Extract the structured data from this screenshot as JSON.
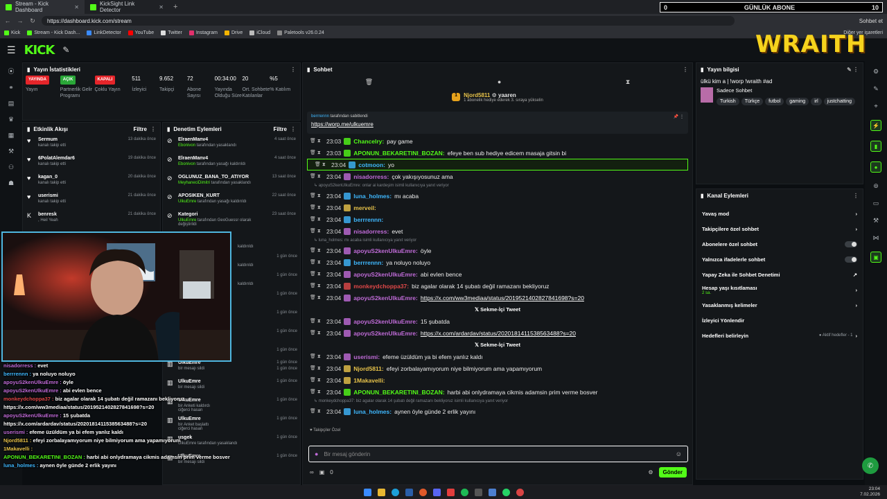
{
  "browser": {
    "tabs": [
      {
        "label": "Stream - Kick Dashboard",
        "active": true
      },
      {
        "label": "KickSight Link Detector",
        "active": false
      }
    ],
    "new_tab": "+",
    "url": "https://dashboard.kick.com/stream",
    "bookmarks": [
      "Kick",
      "Stream - Kick Dash...",
      "LinkDetector",
      "YouTube",
      "Twitter",
      "Instagram",
      "Drive",
      "iCloud",
      "Paletools v26.0.24"
    ],
    "other_bookmarks": "Diğer yer işaretleri",
    "chat_button": "Sohbet et"
  },
  "goal_overlay": {
    "left": "0",
    "label": "GÜNLÜK ABONE",
    "right": "10"
  },
  "wraith": "WRAITH",
  "stats_panel": {
    "title": "Yayın İstatistikleri",
    "items": [
      {
        "val": "YAYINDA",
        "label": "Yayın",
        "color": "#e5252a"
      },
      {
        "val": "AÇIK",
        "label": "Partnerlik Gelir Programı",
        "color": "#2aa738"
      },
      {
        "val": "KAPALI",
        "label": "Çoklu Yayın",
        "color": "#e5252a"
      },
      {
        "val": "511",
        "label": "İzleyici"
      },
      {
        "val": "9.652",
        "label": "Takipçi"
      },
      {
        "val": "72",
        "label": "Abone Sayısı"
      },
      {
        "val": "00:34:00",
        "label": "Yayında Olduğu Süre"
      },
      {
        "val": "20",
        "label": "Ort. Sohbete Katılanlar"
      },
      {
        "val": "%5",
        "label": "% Katılım"
      }
    ]
  },
  "activity": {
    "title": "Etkinlik Akışı",
    "filter": "Filtre",
    "items": [
      {
        "name": "Sermum",
        "sub": "kanalı takip etti",
        "time": "13 dakika önce"
      },
      {
        "name": "6PolatAlemdar6",
        "sub": "kanalı takip etti",
        "time": "19 dakika önce"
      },
      {
        "name": "kagan_0",
        "sub": "kanalı takip etti",
        "time": "20 dakika önce"
      },
      {
        "name": "userismi",
        "sub": "kanalı takip etti",
        "time": "21 dakika önce"
      },
      {
        "name": "benresk",
        "sub": ", Heil Yeah",
        "time": "21 dakika önce"
      }
    ]
  },
  "moderation": {
    "title": "Denetim Eylemleri",
    "filter": "Filtre",
    "items": [
      {
        "name": "ElraenManv4",
        "sub_user": "Ebonivon",
        "sub": "tarafından yasaklandı",
        "time": "4 saat önce"
      },
      {
        "name": "ElraenManv4",
        "sub_user": "Ebonivon",
        "sub": "tarafından yasağı kaldırıldı",
        "time": "4 saat önce"
      },
      {
        "name": "OGLUNUZ_BANA_TO_ATIYOR",
        "sub_user": "MeyhaneciDimitri",
        "sub": "tarafından yasaklandı",
        "time": "13 saat önce"
      },
      {
        "name": "APOSIKEN_KURT",
        "sub_user": "UlkuEmre",
        "sub": "tarafından yasağı kaldırıldı",
        "time": "22 saat önce"
      },
      {
        "name": "Kategori",
        "sub_user": "UlkuEmre",
        "sub": "tarafından GeoGuessr olarak değiştirildi",
        "time": "23 saat önce"
      }
    ],
    "side_texts": [
      "kaldırıldı",
      "kaldırıldı",
      "kaldırıldı"
    ],
    "side_times": [
      "1 gün önce",
      "1 gün önce",
      "1 gün önce",
      "1 gün önce",
      "1 gün önce",
      "1 gün önce",
      "1 gün önce"
    ],
    "lower": [
      {
        "name": "UlkuEmre",
        "sub": "bir mesajı sildi",
        "time": "1 gün önce"
      },
      {
        "name": "UlkuEmre",
        "sub": "bir mesajı sildi",
        "time": "1 gün önce"
      },
      {
        "name": "UlkuEmre",
        "sub": "bir Anketi kaldırdı",
        "sub2": "ciğerci hasan",
        "time": "1 gün önce"
      },
      {
        "name": "UlkuEmre",
        "sub": "bir Anket başlattı",
        "sub2": "ciğerci hasan",
        "time": "1 gün önce"
      },
      {
        "name": "usgek",
        "sub": "UlkuEmre tarafından yasaklandı",
        "time": "1 gün önce"
      },
      {
        "name": "UlkuEmre",
        "sub": "bir mesajı sildi",
        "time": "1 gün önce"
      }
    ]
  },
  "chat": {
    "title": "Sohbet",
    "pinned_top": {
      "user": "Njord5811",
      "to": "yaaren",
      "text": "1 abonelik hediye ederek 3. sıraya yükselin",
      "rank": "1"
    },
    "pinned": {
      "by": "berrrennn",
      "by_text": "tarafından sabitlendi",
      "link": "https://worp.me/ulkuemre"
    },
    "messages": [
      {
        "t": "23:03",
        "user": "Chancelry",
        "color": "#53fc18",
        "text": "pay game"
      },
      {
        "t": "23:03",
        "user": "APONUN_BEKARETINI_BOZAN",
        "color": "#53fc18",
        "text": "efeye ben sub hediye edicem masaja gitsin bi"
      },
      {
        "t": "23:04",
        "user": "cotmoon",
        "color": "#3fb8ff",
        "text": "yo",
        "highlight": true
      },
      {
        "t": "23:04",
        "user": "nisadorress",
        "color": "#c06bd8",
        "text": "çok yakışıyosunuz ama"
      },
      {
        "reply": "apoyuS2kenUlkuEmre: onlar ai kardeşim isimli kullanıcıya yanıt veriyor"
      },
      {
        "t": "23:04",
        "user": "luna_holmes",
        "color": "#3fb8ff",
        "text": "mı acaba"
      },
      {
        "t": "23:04",
        "user": "merveil",
        "color": "#e8c34a",
        "text": ""
      },
      {
        "t": "23:04",
        "user": "berrrennn",
        "color": "#3fb8ff",
        "text": ""
      },
      {
        "t": "23:04",
        "user": "nisadorress",
        "color": "#c06bd8",
        "text": "evet"
      },
      {
        "reply": "luna_holmes: mı acaba isimli kullanıcıya yanıt veriyor"
      },
      {
        "t": "23:04",
        "user": "apoyuS2kenUlkuEmre",
        "color": "#c06bd8",
        "text": "öyle"
      },
      {
        "t": "23:04",
        "user": "berrrennn",
        "color": "#3fb8ff",
        "text": "ya noluyo noluyo"
      },
      {
        "t": "23:04",
        "user": "apoyuS2kenUlkuEmre",
        "color": "#c06bd8",
        "text": "abi evlen bence"
      },
      {
        "t": "23:04",
        "user": "monkeydchoppa37",
        "color": "#e04848",
        "text": "biz agalar olarak 14 şubatı değil ramazanı bekliyoruz"
      },
      {
        "t": "23:04",
        "user": "apoyuS2kenUlkuEmre",
        "color": "#c06bd8",
        "text": "https://x.com/ww3mediaa/status/2019521402827841698?s=20",
        "link": true
      },
      {
        "tweet": "Sekme-İçi Tweet"
      },
      {
        "t": "23:04",
        "user": "apoyuS2kenUlkuEmre",
        "color": "#c06bd8",
        "text": "15 şubatda"
      },
      {
        "t": "23:04",
        "user": "apoyuS2kenUlkuEmre",
        "color": "#c06bd8",
        "text": "https://x.com/ardardav/status/2020181411538563488?s=20",
        "link": true
      },
      {
        "tweet": "Sekme-İçi Tweet"
      },
      {
        "t": "23:04",
        "user": "userismi",
        "color": "#c06bd8",
        "text": "efeme üzüldüm ya bi efem yanlız kaldı"
      },
      {
        "t": "23:04",
        "user": "Njord5811",
        "color": "#e8c34a",
        "text": "efeyi zorbalayamıyorum niye bilmiyorum ama yapamıyorum"
      },
      {
        "t": "23:04",
        "user": "1Makavelli",
        "color": "#e8c34a",
        "text": ""
      },
      {
        "t": "23:04",
        "user": "APONUN_BEKARETINI_BOZAN",
        "color": "#53fc18",
        "text": "harbi abi onlydramaya cikmis adamsin prim verme bosver"
      },
      {
        "reply": "monkeydchoppa37: biz agalar olarak 14 şubatı değil ramazanı bekliyoruz isimli kullanıcıya yanıt veriyor"
      },
      {
        "t": "23:04",
        "user": "luna_holmes",
        "color": "#3fb8ff",
        "text": "aynen öyle günde 2 erlik yayını"
      }
    ],
    "follower_only": "Takipçiler Özel",
    "input_placeholder": "Bir mesaj gönderin",
    "count": "0",
    "send": "Gönder"
  },
  "stream_info": {
    "title": "Yayın bilgisi",
    "stream_title": "ülkü kim a | !worp !wraith #ad",
    "category": "Sadece Sohbet",
    "tags": [
      "Turkish",
      "Türkçe",
      "futbol",
      "gaming",
      "irl",
      "justchatting"
    ]
  },
  "channel_actions": {
    "title": "Kanal Eylemleri",
    "items": [
      {
        "label": "Yavaş mod",
        "kind": "chevron"
      },
      {
        "label": "Takipçilere özel sohbet",
        "kind": "chevron"
      },
      {
        "label": "Abonelere özel sohbet",
        "kind": "toggle"
      },
      {
        "label": "Yalnızca ifadelerle sohbet",
        "kind": "toggle"
      },
      {
        "label": "Yapay Zeka ile Sohbet Denetimi",
        "kind": "external"
      },
      {
        "label": "Hesap yaşı kısıtlaması",
        "sub": "2 sa.",
        "kind": "chevron"
      },
      {
        "label": "Yasaklanmış kelimeler",
        "kind": "chevron"
      },
      {
        "label": "İzleyici Yönlendir",
        "kind": "none"
      },
      {
        "label": "Hedefleri belirleyin",
        "right": "Aktif hedefler - 1",
        "kind": "chevron"
      }
    ]
  },
  "overlay_chat": [
    {
      "user": "nisadorress",
      "color": "#c06bd8",
      "text": "evet"
    },
    {
      "user": "berrrennn",
      "color": "#3fb8ff",
      "text": "ya noluyo noluyo"
    },
    {
      "user": "apoyuS2kenUlkuEmre",
      "color": "#c06bd8",
      "text": "öyle"
    },
    {
      "user": "apoyuS2kenUlkuEmre",
      "color": "#c06bd8",
      "text": "abi evlen bence"
    },
    {
      "user": "monkeydchoppa37",
      "color": "#e04848",
      "text": "biz agalar olarak 14 şubatı değil ramazanı bekliyoruz"
    },
    {
      "user": "",
      "color": "#fff",
      "text": "https://x.com/ww3mediaa/status/2019521402827841698?s=20"
    },
    {
      "user": "apoyuS2kenUlkuEmre",
      "color": "#c06bd8",
      "text": "15 şubatda"
    },
    {
      "user": "",
      "color": "#fff",
      "text": "https://x.com/ardardav/status/2020181411538563488?s=20"
    },
    {
      "user": "userismi",
      "color": "#c06bd8",
      "text": "efeme üzüldüm ya bi efem yanlız kaldı"
    },
    {
      "user": "Njord5811",
      "color": "#e8c34a",
      "text": "efeyi zorbalayamıyorum niye bilmiyorum ama yapamıyorum"
    },
    {
      "user": "1Makavelli",
      "color": "#e8c34a",
      "text": ""
    },
    {
      "user": "APONUN_BEKARETINI_BOZAN",
      "color": "#53fc18",
      "text": "harbi abi onlydramaya cikmis adamsin prim verme bosver"
    },
    {
      "user": "luna_holmes",
      "color": "#3fb8ff",
      "text": "aynen öyle günde 2 erlik yayını"
    }
  ],
  "clock": {
    "time": "23:04",
    "date": "7.02.2026"
  }
}
